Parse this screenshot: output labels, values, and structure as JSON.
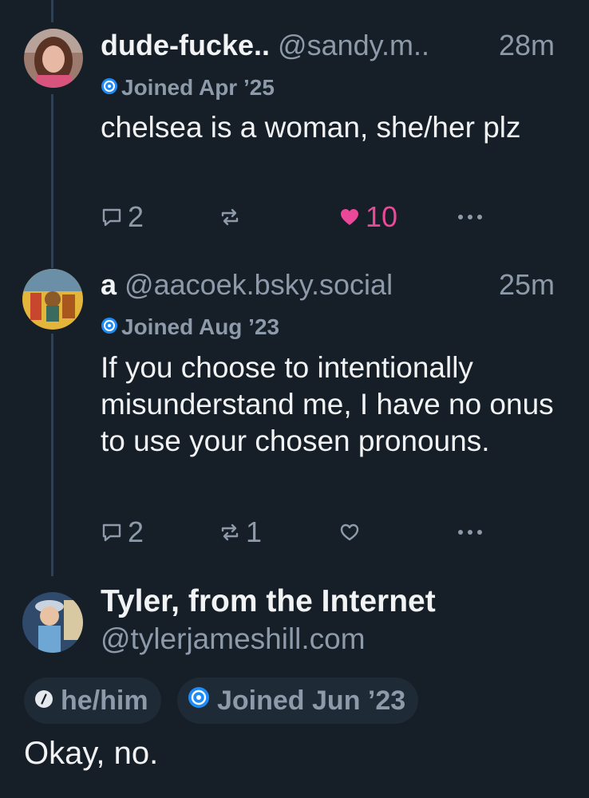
{
  "colors": {
    "background": "#161e27",
    "text_primary": "#f1f3f5",
    "text_secondary": "#8d9aa9",
    "like_active": "#ec4899",
    "badge_blue": "#1d8cf8",
    "thread_line": "#2e4052"
  },
  "posts": [
    {
      "display_name": "dude-fucke..",
      "handle": "@sandy.m..",
      "time": "28m",
      "joined_icon": "bluesky-badge-icon",
      "joined": "Joined Apr ’25",
      "text": "chelsea is a woman, she/her plz",
      "replies": "2",
      "reposts": "",
      "likes": "10",
      "liked": true
    },
    {
      "display_name": "a",
      "handle": "@aacoek.bsky.social",
      "time": "25m",
      "joined_icon": "bluesky-badge-icon",
      "joined": "Joined Aug ’23",
      "text": "If you choose to intentionally misunderstand me, I have no onus to use your chosen pronouns.",
      "replies": "2",
      "reposts": "1",
      "likes": "",
      "liked": false
    }
  ],
  "main_post": {
    "display_name": "Tyler, from the Internet",
    "handle": "@tylerjameshill.com",
    "pronouns_icon": "slash-circle-icon",
    "pronouns": "he/him",
    "joined_icon": "bluesky-badge-icon",
    "joined": "Joined Jun ’23",
    "text": "Okay, no."
  }
}
